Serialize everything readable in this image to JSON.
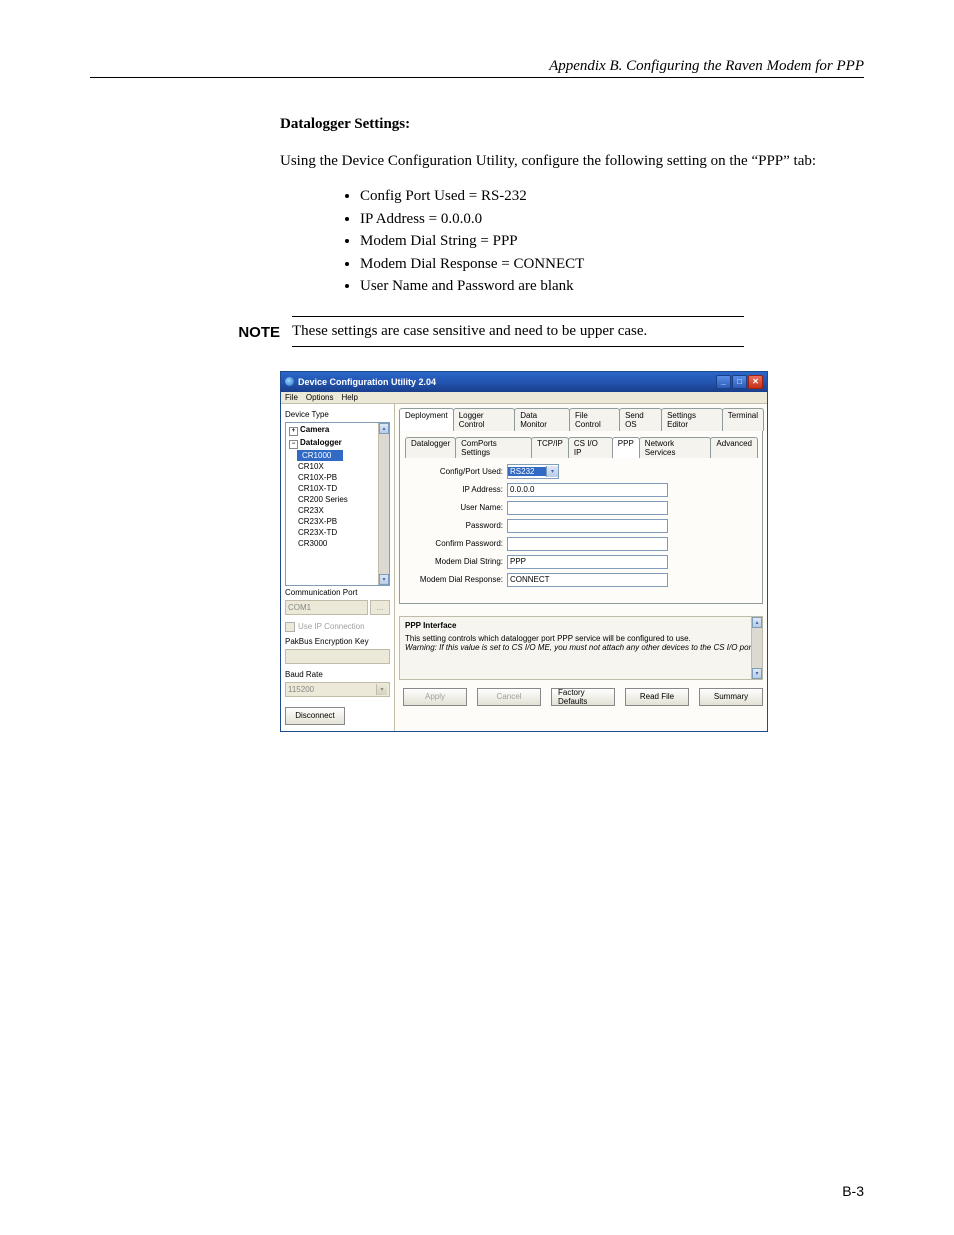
{
  "header": {
    "running_head": "Appendix B.  Configuring the Raven Modem for PPP"
  },
  "doc": {
    "section_title": "Datalogger Settings:",
    "paragraph": "Using the Device Configuration Utility, configure the following setting on the “PPP” tab:",
    "bullets": [
      "Config Port Used = RS-232",
      "IP Address = 0.0.0.0",
      "Modem Dial String = PPP",
      "Modem Dial Response = CONNECT",
      "User Name and Password are blank"
    ],
    "note_label": "NOTE",
    "note_text": "These settings are case sensitive and need to be upper case."
  },
  "window": {
    "title": "Device Configuration Utility 2.04",
    "menu": [
      "File",
      "Options",
      "Help"
    ],
    "left": {
      "device_type_label": "Device Type",
      "tree": {
        "camera_label": "Camera",
        "datalogger_label": "Datalogger",
        "items": [
          "CR1000",
          "CR10X",
          "CR10X-PB",
          "CR10X-TD",
          "CR200 Series",
          "CR23X",
          "CR23X-PB",
          "CR23X-TD",
          "CR3000"
        ],
        "selected": "CR1000",
        "expander_plus": "+",
        "expander_minus": "−"
      },
      "comm_port_label": "Communication Port",
      "comm_port_value": "COM1",
      "use_ip_label": "Use IP Connection",
      "pakbus_label": "PakBus Encryption Key",
      "pakbus_value": "",
      "baud_label": "Baud Rate",
      "baud_value": "115200",
      "disconnect": "Disconnect",
      "ellipsis": "..."
    },
    "tabs": {
      "main": [
        "Deployment",
        "Logger Control",
        "Data Monitor",
        "File Control",
        "Send OS",
        "Settings Editor",
        "Terminal"
      ],
      "active_main": "Deployment",
      "sub": [
        "Datalogger",
        "ComPorts Settings",
        "TCP/IP",
        "CS I/O IP",
        "PPP",
        "Network Services",
        "Advanced"
      ],
      "active_sub": "PPP"
    },
    "form": {
      "config_port_label": "Config/Port Used:",
      "config_port_value": "RS232",
      "ip_label": "IP Address:",
      "ip_value": "0.0.0.0",
      "user_label": "User Name:",
      "user_value": "",
      "pass_label": "Password:",
      "pass_value": "",
      "confirm_label": "Confirm Password:",
      "confirm_value": "",
      "mds_label": "Modem Dial String:",
      "mds_value": "PPP",
      "mdr_label": "Modem Dial Response:",
      "mdr_value": "CONNECT"
    },
    "info": {
      "title": "PPP Interface",
      "text": "This setting controls which datalogger port PPP service will be configured to use.",
      "warning": "Warning: If this value is set to CS I/O ME, you must not attach any other devices to the CS I/O port."
    },
    "buttons": {
      "apply": "Apply",
      "cancel": "Cancel",
      "factory": "Factory Defaults",
      "readfile": "Read File",
      "summary": "Summary"
    }
  },
  "glyphs": {
    "dropdown": "▾",
    "up": "▴",
    "down": "▾",
    "min": "_",
    "max": "□",
    "close": "✕"
  },
  "footer": {
    "page": "B-3"
  }
}
